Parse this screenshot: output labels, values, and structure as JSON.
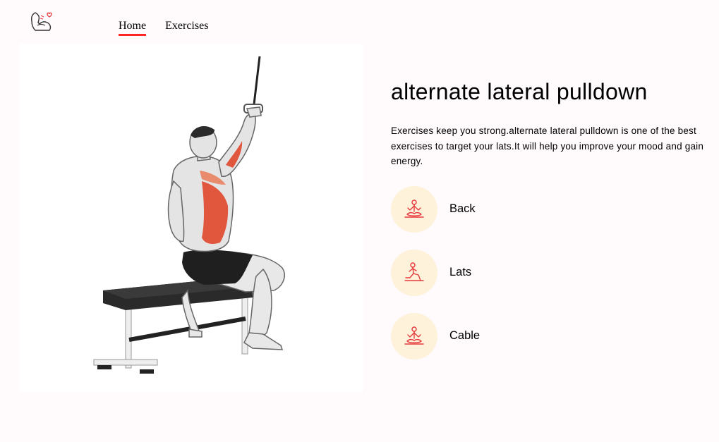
{
  "brand": {
    "logo_icon": "flexed-arm-heart-icon",
    "accent_color": "#ff2625"
  },
  "nav": {
    "home_label": "Home",
    "exercises_label": "Exercises"
  },
  "exercise": {
    "image_alt": "alternate lateral pulldown",
    "title": "alternate lateral pulldown",
    "description": "Exercises keep you strong.alternate lateral pulldown is one of the best exercises to target your lats.It will help you improve your mood and gain energy.",
    "details": [
      {
        "label": "Back",
        "icon": "meditation-body-part-icon"
      },
      {
        "label": "Lats",
        "icon": "lunge-target-icon"
      },
      {
        "label": "Cable",
        "icon": "meditation-equipment-icon"
      }
    ]
  },
  "colors": {
    "page_background": "#fffafb",
    "detail_circle": "#fff2db",
    "icon_stroke": "#e5383b"
  }
}
